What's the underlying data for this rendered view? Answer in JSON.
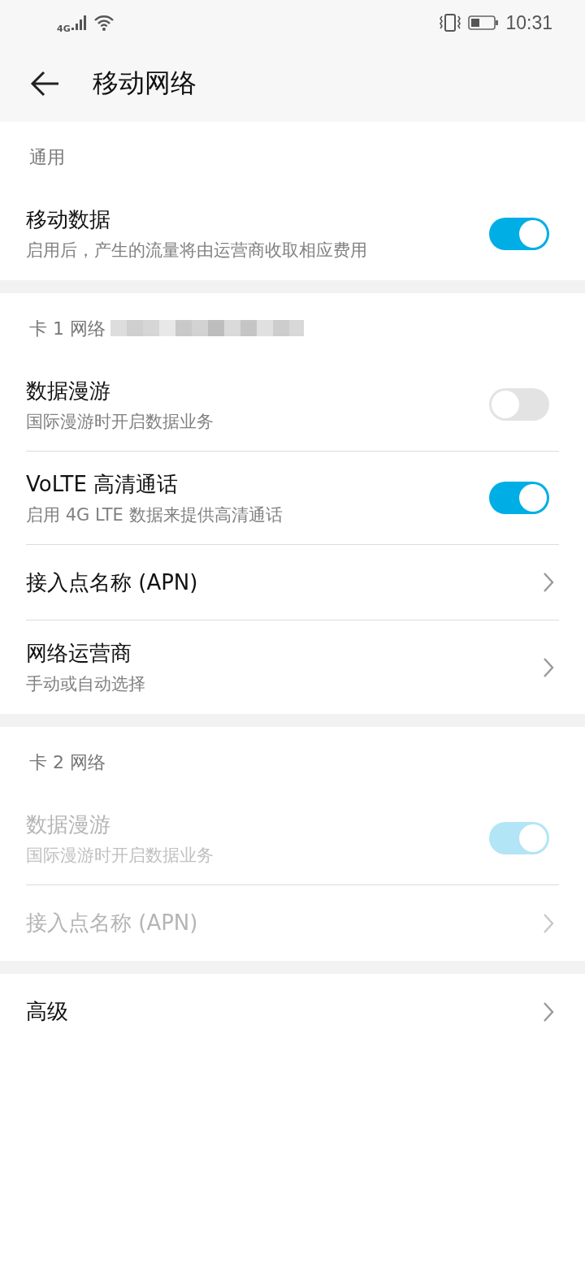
{
  "status_bar": {
    "network": "4G",
    "time": "10:31"
  },
  "header": {
    "title": "移动网络"
  },
  "sections": [
    {
      "title": "通用",
      "redacted": false,
      "items": [
        {
          "kind": "toggle",
          "title": "移动数据",
          "subtitle": "启用后，产生的流量将由运营商收取相应费用",
          "on": true,
          "disabled": false
        }
      ]
    },
    {
      "title": "卡 1 网络",
      "redacted": true,
      "items": [
        {
          "kind": "toggle",
          "title": "数据漫游",
          "subtitle": "国际漫游时开启数据业务",
          "on": false,
          "disabled": false
        },
        {
          "kind": "toggle",
          "title": "VoLTE 高清通话",
          "subtitle": "启用 4G LTE 数据来提供高清通话",
          "on": true,
          "disabled": false
        },
        {
          "kind": "link",
          "title": "接入点名称 (APN)",
          "disabled": false
        },
        {
          "kind": "link",
          "title": "网络运营商",
          "subtitle": "手动或自动选择",
          "disabled": false
        }
      ]
    },
    {
      "title": "卡 2 网络",
      "redacted": false,
      "items": [
        {
          "kind": "toggle",
          "title": "数据漫游",
          "subtitle": "国际漫游时开启数据业务",
          "on": true,
          "disabled": true
        },
        {
          "kind": "link",
          "title": "接入点名称 (APN)",
          "disabled": true
        }
      ]
    },
    {
      "items": [
        {
          "kind": "link",
          "title": "高级",
          "disabled": false
        }
      ]
    }
  ]
}
